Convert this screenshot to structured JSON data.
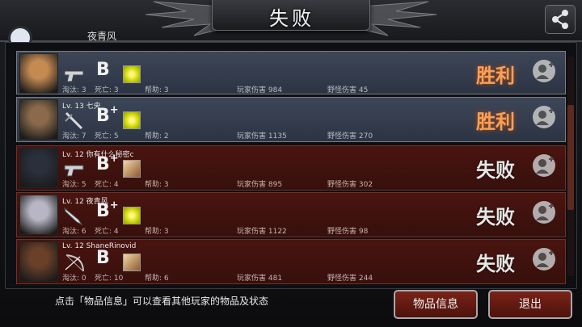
{
  "header": {
    "title": "失败",
    "peek_name": "夜青风"
  },
  "players": [
    {
      "level_name": "",
      "grade": "B",
      "grade_plus": "",
      "weapon": "pistol-icon",
      "item": "yellow-gem-icon",
      "eliminations": "淘汰: 3",
      "deaths": "死亡: 3",
      "assists": "帮助: 3",
      "player_damage": "玩家伤害 984",
      "monster_damage": "野怪伤害 45",
      "result": "胜利",
      "outcome": "win",
      "avatar_color": "#c58a52"
    },
    {
      "level_name": "Lv. 13 七央",
      "grade": "B",
      "grade_plus": "+",
      "weapon": "sword-icon",
      "item": "yellow-gem-icon",
      "eliminations": "淘汰: 7",
      "deaths": "死亡: 5",
      "assists": "帮助: 2",
      "player_damage": "玩家伤害 1135",
      "monster_damage": "野怪伤害 270",
      "result": "胜利",
      "outcome": "win",
      "avatar_color": "#8a6a4a"
    },
    {
      "level_name": "Lv. 12 你有什么秘密c",
      "grade": "B",
      "grade_plus": "+",
      "weapon": "pistol-icon",
      "item": "character-card-icon",
      "eliminations": "淘汰: 5",
      "deaths": "死亡: 4",
      "assists": "帮助: 3",
      "player_damage": "玩家伤害 895",
      "monster_damage": "野怪伤害 302",
      "result": "失败",
      "outcome": "lose",
      "avatar_color": "#2a2f3c"
    },
    {
      "level_name": "Lv. 12 夜青风",
      "grade": "B",
      "grade_plus": "+",
      "weapon": "knife-icon",
      "item": "yellow-gem-icon",
      "eliminations": "淘汰: 6",
      "deaths": "死亡: 4",
      "assists": "帮助: 3",
      "player_damage": "玩家伤害 1122",
      "monster_damage": "野怪伤害 98",
      "result": "失败",
      "outcome": "lose",
      "avatar_color": "#b8b6c4"
    },
    {
      "level_name": "Lv. 12 ShaneRinovid",
      "grade": "B",
      "grade_plus": "",
      "weapon": "bow-icon",
      "item": "character-card-icon",
      "eliminations": "淘汰: 0",
      "deaths": "死亡: 10",
      "assists": "帮助: 6",
      "player_damage": "玩家伤害 481",
      "monster_damage": "野怪伤害 244",
      "result": "失败",
      "outcome": "lose",
      "avatar_color": "#6a4028"
    }
  ],
  "footer": {
    "hint": "点击「物品信息」可以查看其他玩家的物品及状态",
    "items_button": "物品信息",
    "exit_button": "退出"
  },
  "colors": {
    "win_text": "#f7a05a",
    "lose_row": "#4a1410",
    "win_row": "#3d4657",
    "button": "#7a2318"
  }
}
